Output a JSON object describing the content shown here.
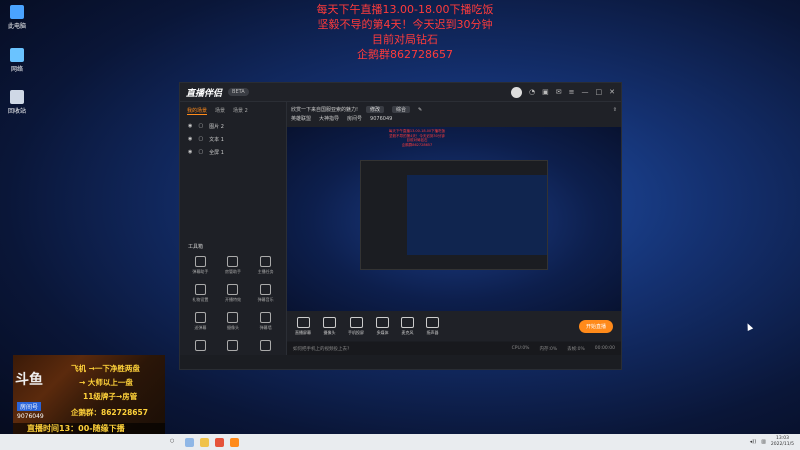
{
  "desktop": {
    "icons": [
      {
        "label": "此电脑",
        "icon": "computer-icon"
      },
      {
        "label": "网络",
        "icon": "network-icon"
      },
      {
        "label": "回收站",
        "icon": "recycle-bin-icon"
      }
    ]
  },
  "overlay": {
    "lines": [
      "每天下午直播13.00-18.00下播吃饭",
      "坚毅不导的第4天！今天迟到30分钟",
      "目前对局钻石",
      "企鹅群862728657"
    ]
  },
  "app": {
    "title": "直播伴侣",
    "beta": "BETA",
    "tabs": [
      "我的场景",
      "场景",
      "场景 2"
    ],
    "scenes": [
      "图片 2",
      "文本 1",
      "全屏 1"
    ],
    "tools_title": "工具箱",
    "tools": [
      "弹幕助手",
      "房管助手",
      "主播任务",
      "礼物设置",
      "开播特效",
      "弹幕音乐",
      "送弹幕",
      "摄像头",
      "弹幕墙",
      "",
      "",
      ""
    ],
    "room_title": "欣赏一下来自国服亚索的魅力!",
    "edit_btn": "修改",
    "category": "综合",
    "room_tags": [
      "英雄联盟",
      "大神指导",
      "房间号",
      "9076049"
    ],
    "bottom_buttons": [
      "直播屏幕",
      "摄像头",
      "手机投屏",
      "多媒体",
      "麦克风",
      "扬声器"
    ],
    "live_button": "开始直播",
    "status_hint": "如何把手机上的视频投上去?",
    "status_values": [
      "CPU:0%",
      "内存:0%",
      "丢帧:0%",
      "00:00:00"
    ],
    "colors": {
      "accent": "#ff8a1a",
      "overlay_red": "#ff3b3b"
    }
  },
  "camera": {
    "lines": [
      "飞机 →一下净胜两盘",
      "→ 大师以上一盘",
      "11级牌子→房管"
    ],
    "qq": "企鹅群：862728657",
    "logo": "斗鱼",
    "room_label": "房间号",
    "room_id": "9076049",
    "bottom": "直播时间13：00-随缘下播"
  },
  "taskbar": {
    "time": "13:03",
    "date": "2022/11/5"
  }
}
